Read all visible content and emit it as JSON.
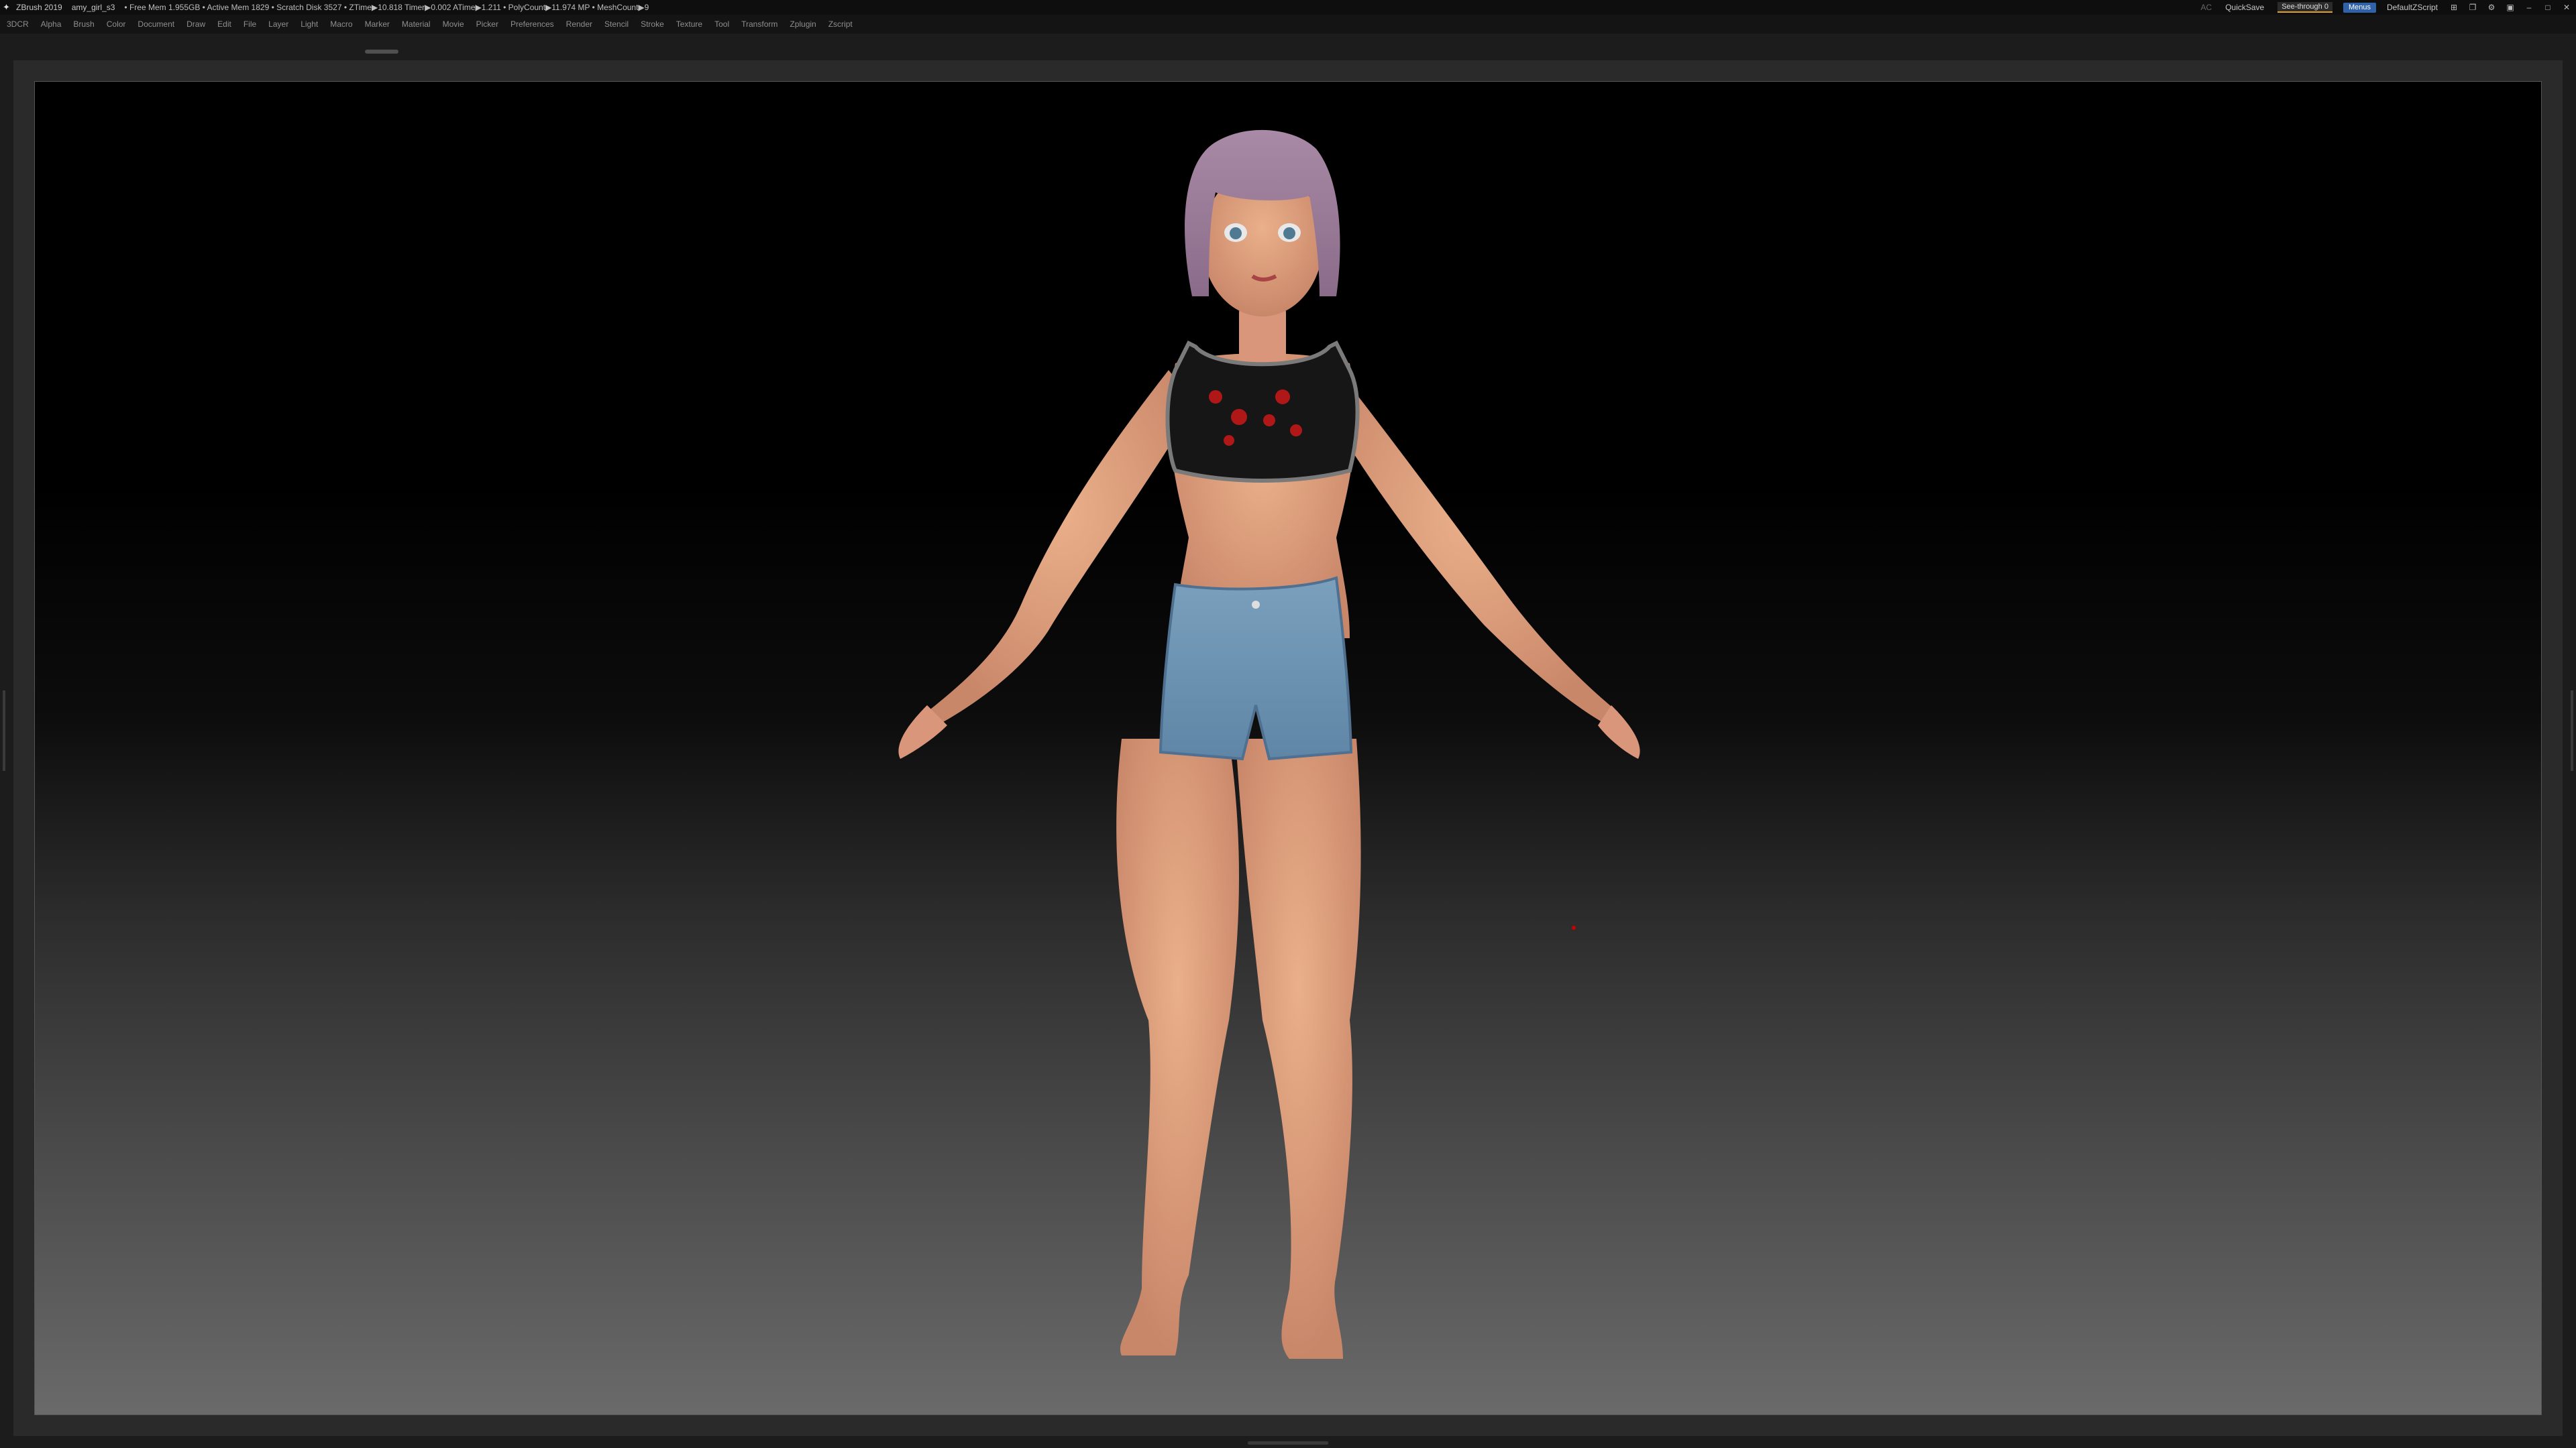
{
  "titlebar": {
    "app": "ZBrush 2019",
    "file": "amy_girl_s3",
    "stats": "• Free Mem 1.955GB • Active Mem 1829 • Scratch Disk 3527 • ZTime▶10.818 Timer▶0.002 ATime▶1.211 • PolyCount▶11.974 MP • MeshCount▶9",
    "ac": "AC",
    "quicksave": "QuickSave",
    "see_through": "See-through 0",
    "menus": "Menus",
    "default_script": "DefaultZScript"
  },
  "menubar": {
    "items": [
      "3DCR",
      "Alpha",
      "Brush",
      "Color",
      "Document",
      "Draw",
      "Edit",
      "File",
      "Layer",
      "Light",
      "Macro",
      "Marker",
      "Material",
      "Movie",
      "Picker",
      "Preferences",
      "Render",
      "Stencil",
      "Stroke",
      "Texture",
      "Tool",
      "Transform",
      "Zplugin",
      "Zscript"
    ]
  },
  "colors": {
    "skin": "#e0a07a",
    "hair": "#9b7b9a",
    "shorts": "#6d93b2",
    "top": "#151515",
    "accent_red": "#b01818"
  },
  "icons": [
    "zbrush-logo-icon",
    "layout-icon",
    "window-icon",
    "minimize-icon",
    "maximize-icon",
    "close-icon"
  ]
}
